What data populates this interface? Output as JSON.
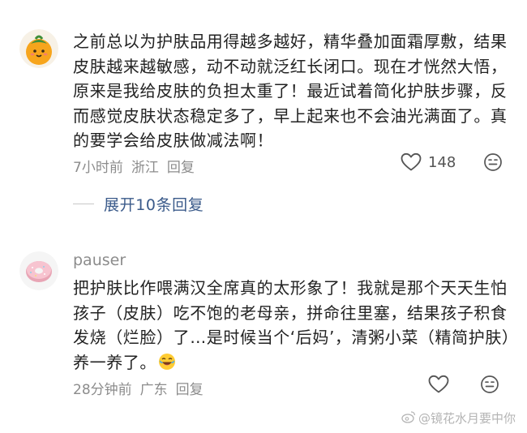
{
  "comments": [
    {
      "username": "",
      "content": "之前总以为护肤品用得越多越好，精华叠加面霜厚敷，结果皮肤越来越敏感，动不动就泛红长闭口。现在才恍然大悟，原来是我给皮肤的负担太重了！最近试着简化护肤步骤，反而感觉皮肤状态稳定多了，早上起来也不会油光满面了。真的要学会给皮肤做减法啊！",
      "time": "7小时前",
      "location": "浙江",
      "reply_label": "回复",
      "likes": "148",
      "avatar_icon": "orange-fruit-avatar-icon"
    },
    {
      "username": "pauser",
      "content": "把护肤比作喂满汉全席真的太形象了！我就是那个天天生怕孩子（皮肤）吃不饱的老母亲，拼命往里塞，结果孩子积食发烧（烂脸）了…是时候当个‘后妈’，清粥小菜（精简护肤）养一养了。",
      "emoji": "laughing-emoji-icon",
      "time": "28分钟前",
      "location": "广东",
      "reply_label": "回复",
      "likes": "",
      "avatar_icon": "donut-avatar-icon"
    }
  ],
  "expand_replies": {
    "label": "展开10条回复"
  },
  "watermark": {
    "text": "@镜花水月要中你",
    "icon": "weibo-icon"
  },
  "colors": {
    "link_blue": "#3a5a8a",
    "meta_gray": "#8c8c8c"
  }
}
